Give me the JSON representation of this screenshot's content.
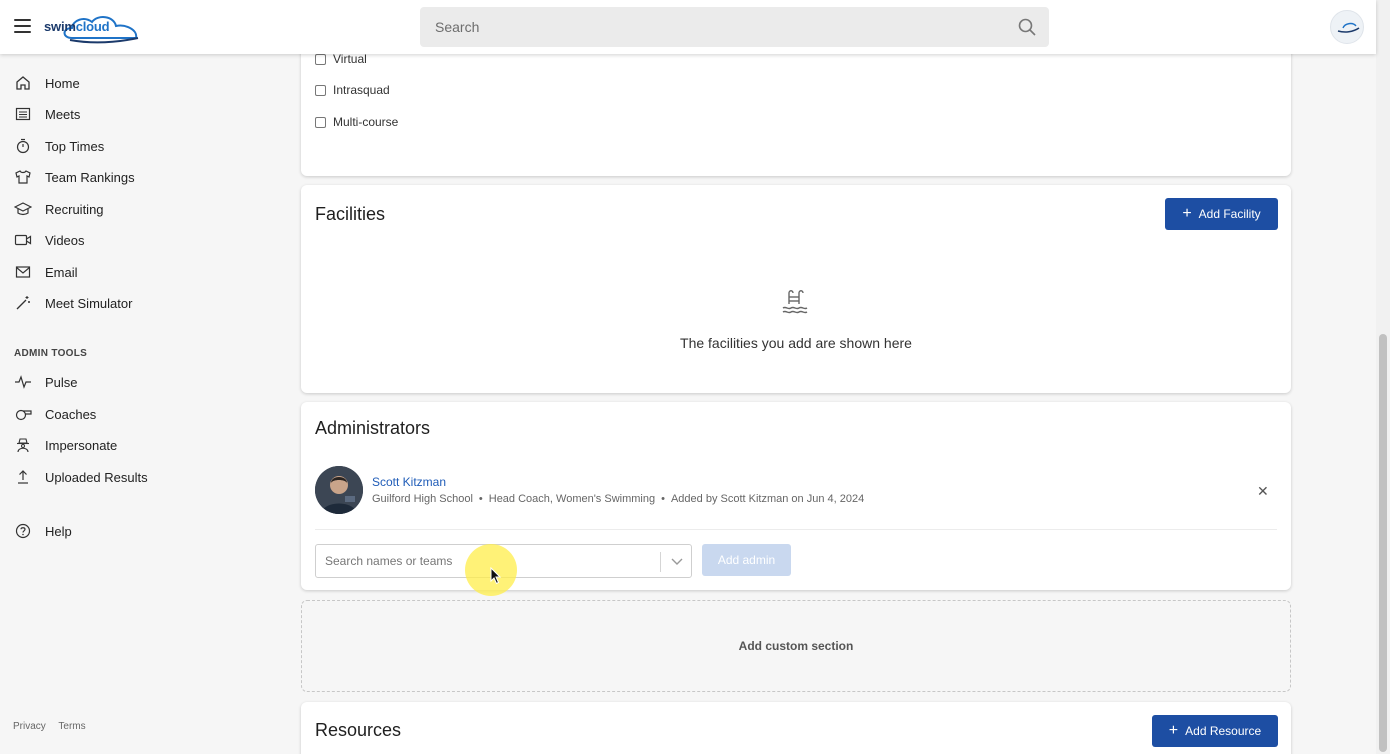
{
  "header": {
    "logo_text": "swimcloud",
    "search_placeholder": "Search"
  },
  "sidebar": {
    "items": [
      {
        "label": "Home",
        "icon": "home-icon"
      },
      {
        "label": "Meets",
        "icon": "list-icon"
      },
      {
        "label": "Top Times",
        "icon": "stopwatch-icon"
      },
      {
        "label": "Team Rankings",
        "icon": "shirt-icon"
      },
      {
        "label": "Recruiting",
        "icon": "graduation-cap-icon"
      },
      {
        "label": "Videos",
        "icon": "video-icon"
      },
      {
        "label": "Email",
        "icon": "mail-icon"
      },
      {
        "label": "Meet Simulator",
        "icon": "magic-wand-icon"
      }
    ],
    "admin_tools_label": "ADMIN TOOLS",
    "admin_items": [
      {
        "label": "Pulse",
        "icon": "pulse-icon"
      },
      {
        "label": "Coaches",
        "icon": "whistle-icon"
      },
      {
        "label": "Impersonate",
        "icon": "spy-icon"
      },
      {
        "label": "Uploaded Results",
        "icon": "upload-icon"
      }
    ],
    "help": {
      "label": "Help",
      "icon": "help-icon"
    },
    "footer": {
      "privacy": "Privacy",
      "terms": "Terms"
    }
  },
  "filters": {
    "options": [
      {
        "label": "Virtual",
        "checked": false
      },
      {
        "label": "Intrasquad",
        "checked": false
      },
      {
        "label": "Multi-course",
        "checked": false
      }
    ]
  },
  "facilities": {
    "title": "Facilities",
    "add_button": "Add Facility",
    "empty_text": "The facilities you add are shown here"
  },
  "administrators": {
    "title": "Administrators",
    "admin": {
      "name": "Scott Kitzman",
      "school": "Guilford High School",
      "role": "Head Coach, Women's Swimming",
      "added": "Added by Scott Kitzman on Jun 4, 2024"
    },
    "search_placeholder": "Search names or teams",
    "add_button": "Add admin"
  },
  "custom_section": {
    "label": "Add custom section"
  },
  "resources": {
    "title": "Resources",
    "add_button": "Add Resource"
  },
  "colors": {
    "primary": "#1d4ea3",
    "link": "#1f5cb8",
    "disabled": "#c9d8ef"
  }
}
